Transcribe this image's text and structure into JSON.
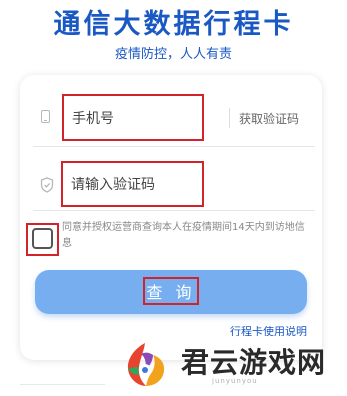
{
  "header": {
    "title": "通信大数据行程卡",
    "subtitle": "疫情防控，人人有责"
  },
  "form": {
    "phone_placeholder": "手机号",
    "get_code_label": "获取验证码",
    "code_placeholder": "请输入验证码",
    "agreement_text": "同意并授权运营商查询本人在疫情期间14天内到访地信息",
    "query_button_label": "查 询",
    "bottom_link_text": "行程卡使用说明"
  },
  "watermark": {
    "brand": "君云游戏网",
    "site": "junyunyou"
  },
  "colors": {
    "brand_blue": "#1a58c4",
    "button_blue": "#76aef0",
    "highlight_red": "#d0242a"
  },
  "icons": {
    "phone_field_icon": "phone-icon",
    "code_field_icon": "shield-icon"
  }
}
